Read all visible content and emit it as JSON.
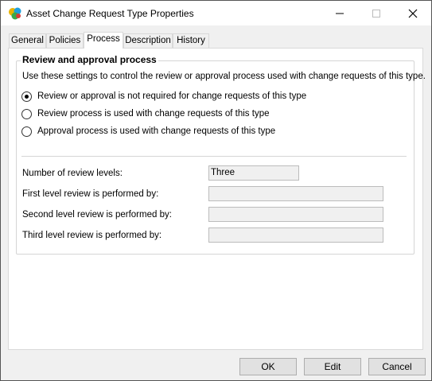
{
  "window": {
    "title": "Asset Change Request Type Properties",
    "accent": "#ffffff"
  },
  "tabs": [
    {
      "label": "General"
    },
    {
      "label": "Policies"
    },
    {
      "label": "Process",
      "active": true
    },
    {
      "label": "Description"
    },
    {
      "label": "History"
    }
  ],
  "process": {
    "group_title": "Review and approval process",
    "description": "Use these settings to control the review or approval process used with change requests of this type.",
    "options": [
      {
        "label": "Review or approval is not required for change requests of this type",
        "checked": true
      },
      {
        "label": "Review process is used with change requests of this type",
        "checked": false
      },
      {
        "label": "Approval process is used with change requests of this type",
        "checked": false
      }
    ],
    "fields": [
      {
        "label": "Number of review levels:",
        "value": "Three"
      },
      {
        "label": "First level review is performed by:",
        "value": ""
      },
      {
        "label": "Second level review is performed by:",
        "value": ""
      },
      {
        "label": "Third level review is performed by:",
        "value": ""
      }
    ]
  },
  "buttons": {
    "ok": "OK",
    "edit": "Edit",
    "cancel": "Cancel"
  }
}
